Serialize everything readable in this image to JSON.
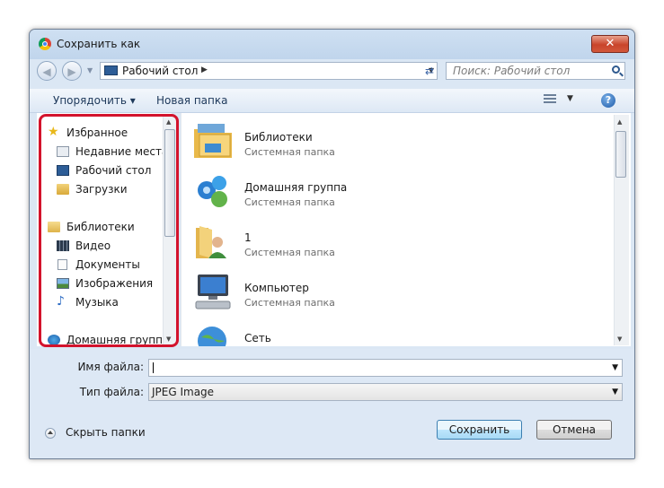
{
  "window": {
    "title": "Сохранить как",
    "close_label": "✕"
  },
  "navbar": {
    "back_icon": "back-arrow-icon",
    "forward_icon": "forward-arrow-icon",
    "address": "Рабочий стол",
    "search_placeholder": "Поиск: Рабочий стол"
  },
  "toolbar": {
    "organize": "Упорядочить ▾",
    "new_folder": "Новая папка",
    "help": "?"
  },
  "nav_pane": {
    "favorites": {
      "label": "Избранное",
      "items": [
        {
          "label": "Недавние места",
          "icon": "recent-places-icon"
        },
        {
          "label": "Рабочий стол",
          "icon": "desktop-icon"
        },
        {
          "label": "Загрузки",
          "icon": "downloads-icon"
        }
      ]
    },
    "libraries": {
      "label": "Библиотеки",
      "items": [
        {
          "label": "Видео",
          "icon": "video-icon"
        },
        {
          "label": "Документы",
          "icon": "documents-icon"
        },
        {
          "label": "Изображения",
          "icon": "images-icon"
        },
        {
          "label": "Музыка",
          "icon": "music-icon"
        }
      ]
    },
    "homegroup": {
      "label": "Домашняя группа"
    }
  },
  "files": [
    {
      "name": "Библиотеки",
      "type": "Системная папка",
      "icon": "libraries-folder-icon"
    },
    {
      "name": "Домашняя группа",
      "type": "Системная папка",
      "icon": "homegroup-icon"
    },
    {
      "name": "1",
      "type": "Системная папка",
      "icon": "user-folder-icon"
    },
    {
      "name": "Компьютер",
      "type": "Системная папка",
      "icon": "computer-icon"
    },
    {
      "name": "Сеть",
      "type": "",
      "icon": "network-icon"
    }
  ],
  "form": {
    "filename_label": "Имя файла:",
    "filename_value": "",
    "filetype_label": "Тип файла:",
    "filetype_value": "JPEG Image"
  },
  "footer": {
    "hide_folders": "Скрыть папки",
    "save": "Сохранить",
    "cancel": "Отмена"
  }
}
